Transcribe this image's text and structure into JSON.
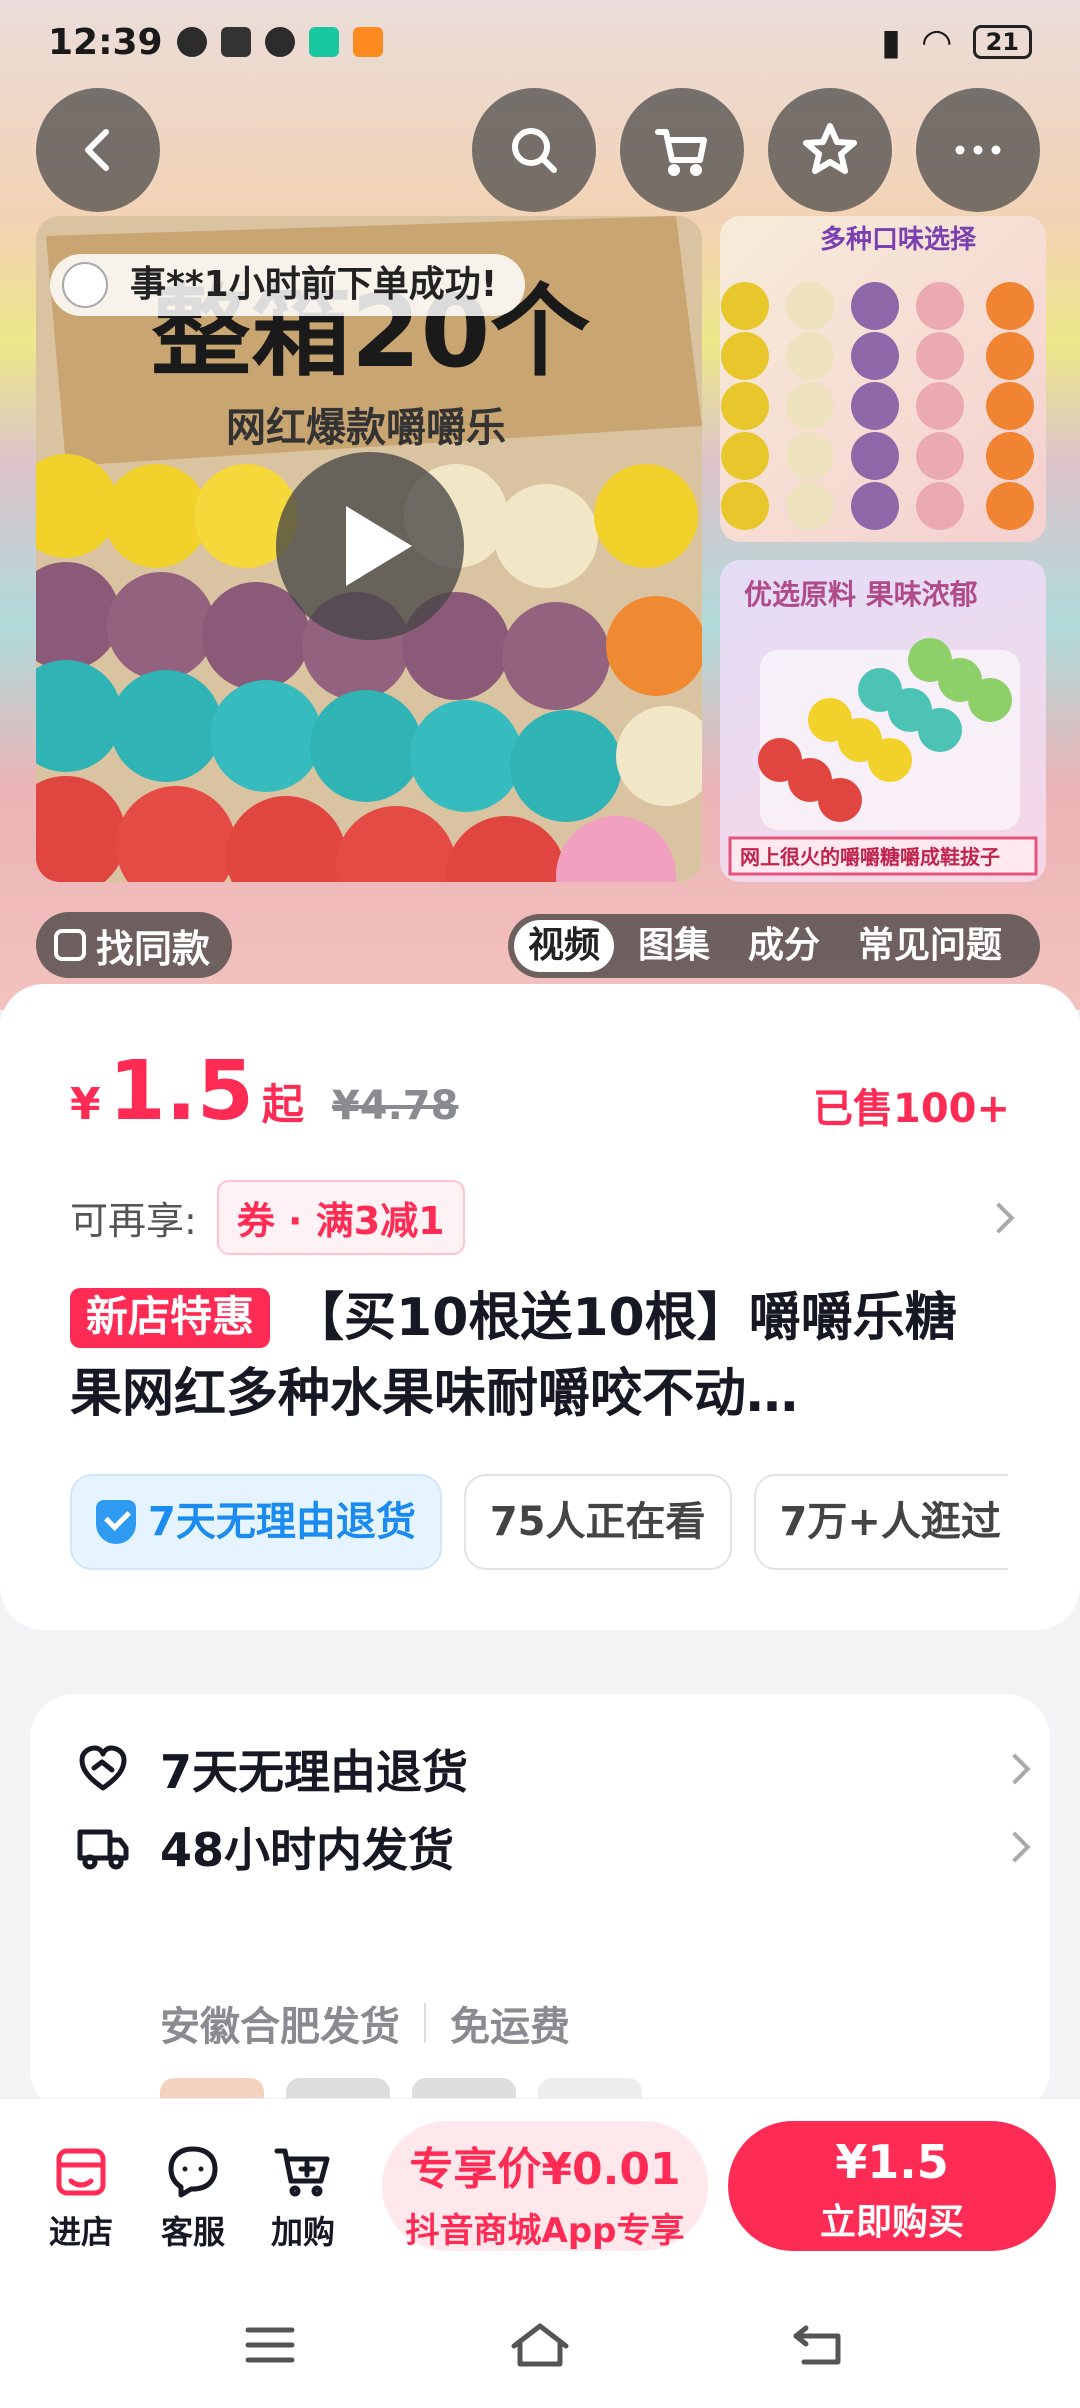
{
  "status_bar": {
    "time": "12:39",
    "battery": "21"
  },
  "gallery": {
    "toast": "事**1小时前下单成功!",
    "find_same": "找同款",
    "media_tabs": [
      "视频",
      "图集",
      "成分",
      "常见问题"
    ],
    "active_tab": "视频"
  },
  "main_image_text": {
    "headline": "整箱20个",
    "subline": "网红爆款嚼嚼乐"
  },
  "side_images": {
    "top_caption": "多种口味选择",
    "bottom_caption": "优选原料 果味浓郁",
    "bottom_banner": "网上很火的嚼嚼糖嚼成鞋拔子"
  },
  "product": {
    "currency": "¥",
    "price": "1.5",
    "price_suffix": "起",
    "original_price": "¥4.78",
    "sold": "已售100+",
    "coupon_label": "可再享:",
    "coupon": "券 · 满3减1",
    "new_shop_badge": "新店特惠",
    "title": "【买10根送10根】嚼嚼乐糖果网红多种水果味耐嚼咬不动…",
    "tags": [
      "7天无理由退货",
      "75人正在看",
      "7万+人逛过"
    ]
  },
  "service": {
    "return_policy": "7天无理由退货",
    "shipping": "48小时内发货",
    "origin": "安徽合肥发货",
    "shipping_fee": "免运费"
  },
  "action_bar": {
    "store": "进店",
    "support": "客服",
    "add_cart": "加购",
    "exclusive_price": "专享价¥0.01",
    "exclusive_note": "抖音商城App专享",
    "buy_price": "¥1.5",
    "buy_label": "立即购买"
  },
  "colors": {
    "accent": "#fe2c55",
    "accent_light": "#ffe8ec",
    "text": "#161823",
    "muted": "#8a8b91",
    "return_blue": "#1c8bf0"
  }
}
